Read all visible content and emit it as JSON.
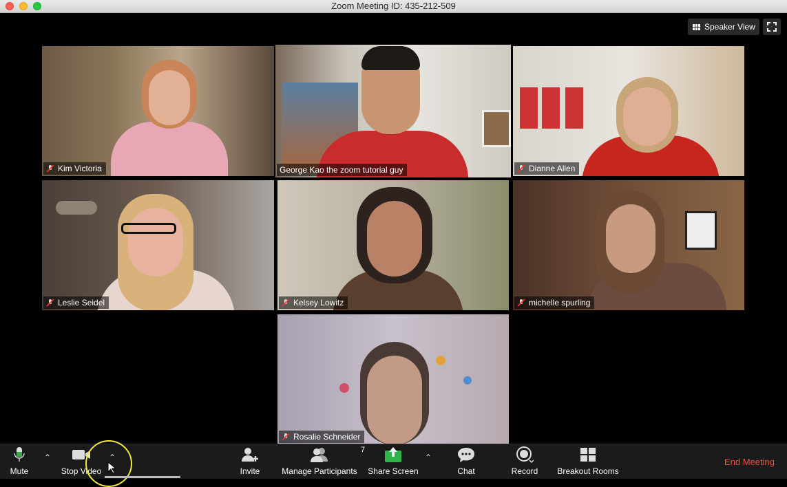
{
  "window": {
    "title": "Zoom Meeting ID: 435-212-509"
  },
  "view_controls": {
    "speaker_view_label": "Speaker View"
  },
  "participants": [
    {
      "name": "Kim Victoria",
      "muted": true,
      "active": false
    },
    {
      "name": "George Kao the zoom tutorial guy",
      "muted": false,
      "active": true
    },
    {
      "name": "Dianne Allen",
      "muted": true,
      "active": false
    },
    {
      "name": "Leslie Seidel",
      "muted": true,
      "active": false
    },
    {
      "name": "Kelsey Lowitz",
      "muted": true,
      "active": false
    },
    {
      "name": "michelle spurling",
      "muted": true,
      "active": false
    },
    {
      "name": "Rosalie Schneider",
      "muted": true,
      "active": false
    }
  ],
  "toolbar": {
    "mute_label": "Mute",
    "stop_video_label": "Stop Video",
    "invite_label": "Invite",
    "manage_participants_label": "Manage Participants",
    "participant_count": "7",
    "share_screen_label": "Share Screen",
    "chat_label": "Chat",
    "record_label": "Record",
    "breakout_rooms_label": "Breakout Rooms",
    "end_meeting_label": "End Meeting"
  },
  "colors": {
    "active_speaker_border": "#d7ef79",
    "share_green": "#2fb44a",
    "end_red": "#ef4b40"
  },
  "icons": [
    "mic-icon",
    "camera-icon",
    "invite-icon",
    "participants-icon",
    "share-screen-icon",
    "chat-icon",
    "record-icon",
    "breakout-icon",
    "fullscreen-icon",
    "speaker-view-icon",
    "mic-muted-icon"
  ]
}
